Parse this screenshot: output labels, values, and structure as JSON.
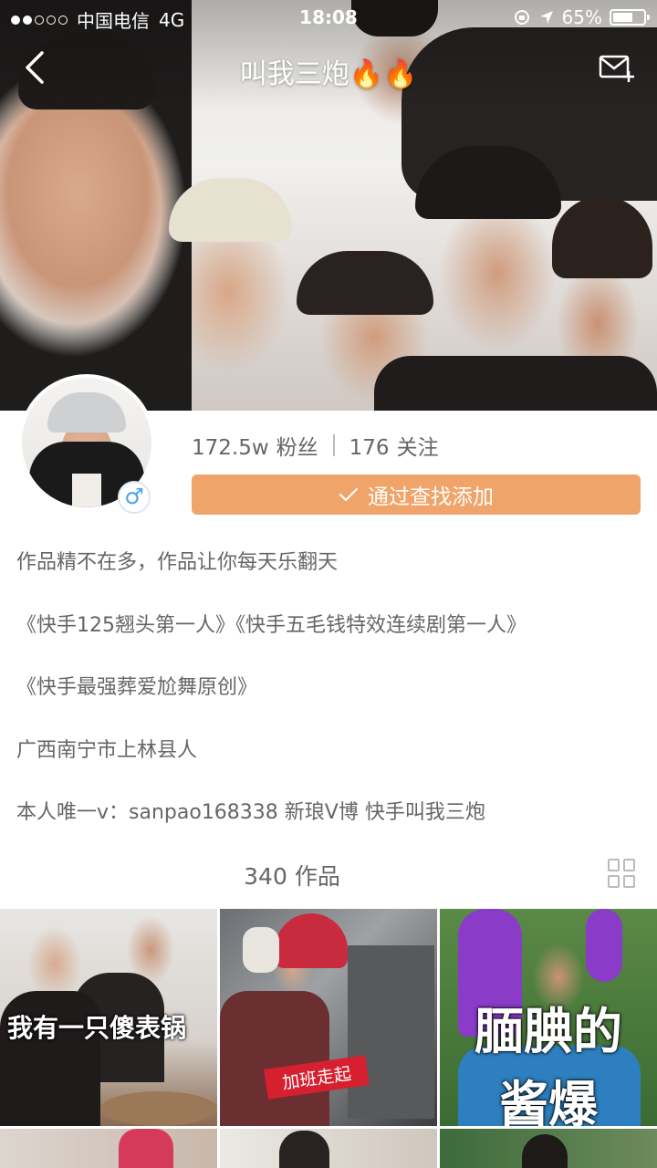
{
  "status_bar": {
    "carrier": "中国电信",
    "network": "4G",
    "time": "18:08",
    "battery": "65%",
    "battery_level": 0.65,
    "signal_bars_filled": 2,
    "signal_bars_total": 5
  },
  "nav": {
    "title": "叫我三炮",
    "title_emoji": "🔥🔥",
    "back_icon": "chevron-left-icon",
    "mail_icon": "mail-add-icon"
  },
  "profile": {
    "followers_value": "172.5w",
    "followers_label": "粉丝",
    "following_value": "176",
    "following_label": "关注",
    "gender_symbol": "♂",
    "add_button_label": "通过查找添加",
    "accent_color": "#f0a469"
  },
  "bio": [
    "作品精不在多，作品让你每天乐翻天",
    "《快手125翘头第一人》《快手五毛钱特效连续剧第一人》",
    "《快手最强葬爱尬舞原创》",
    "广西南宁市上林县人",
    "本人唯一v：sanpao168338  新琅V博 快手叫我三炮"
  ],
  "works": {
    "count_label": "340 作品",
    "layout_icon": "grid-icon"
  },
  "thumbnails": [
    {
      "caption": "我有一只傻表锅"
    },
    {
      "caption": "加班走起"
    },
    {
      "caption_line1": "腼腆的",
      "caption_line2": "酱爆"
    }
  ]
}
